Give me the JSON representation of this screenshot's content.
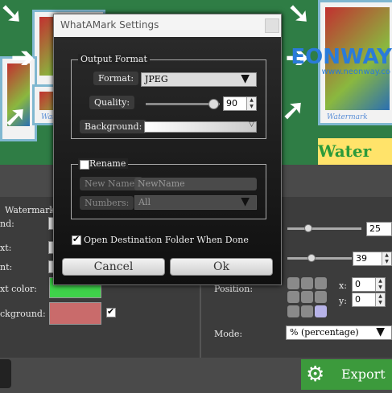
{
  "background_app": {
    "preview": {
      "watermark_text": "Watermark",
      "brand": "EONWAY",
      "brand_url": "www.neonway.co",
      "banner_text": "Water"
    },
    "left_labels": [
      "Watermark",
      "nd:",
      "xt:",
      "nt:",
      "xt color:",
      "ckground:"
    ],
    "right": {
      "slider1_value": "25",
      "slider2_value": "39",
      "position_label": "Position:",
      "x_label": "x:",
      "x_value": "0",
      "y_label": "y:",
      "y_value": "0",
      "mode_label": "Mode:",
      "mode_value": "% (percentage)"
    },
    "export_label": "Export",
    "colors": {
      "text_color": "#3fd24a",
      "background": "#c96b6b",
      "export_bg": "#3c9a3c"
    }
  },
  "dialog": {
    "title": "WhatAMark Settings",
    "output_format": {
      "group_title": "Output Format",
      "format_label": "Format:",
      "format_value": "JPEG",
      "quality_label": "Quality:",
      "quality_value": "90",
      "quality_fraction": 0.9,
      "background_label": "Background:"
    },
    "rename": {
      "group_title": "Rename",
      "checked": false,
      "new_name_label": "New Name:",
      "new_name_value": "NewName",
      "numbers_label": "Numbers:",
      "numbers_value": "All"
    },
    "open_folder": {
      "label": "Open Destination Folder When Done",
      "checked": true
    },
    "buttons": {
      "cancel": "Cancel",
      "ok": "Ok"
    }
  }
}
